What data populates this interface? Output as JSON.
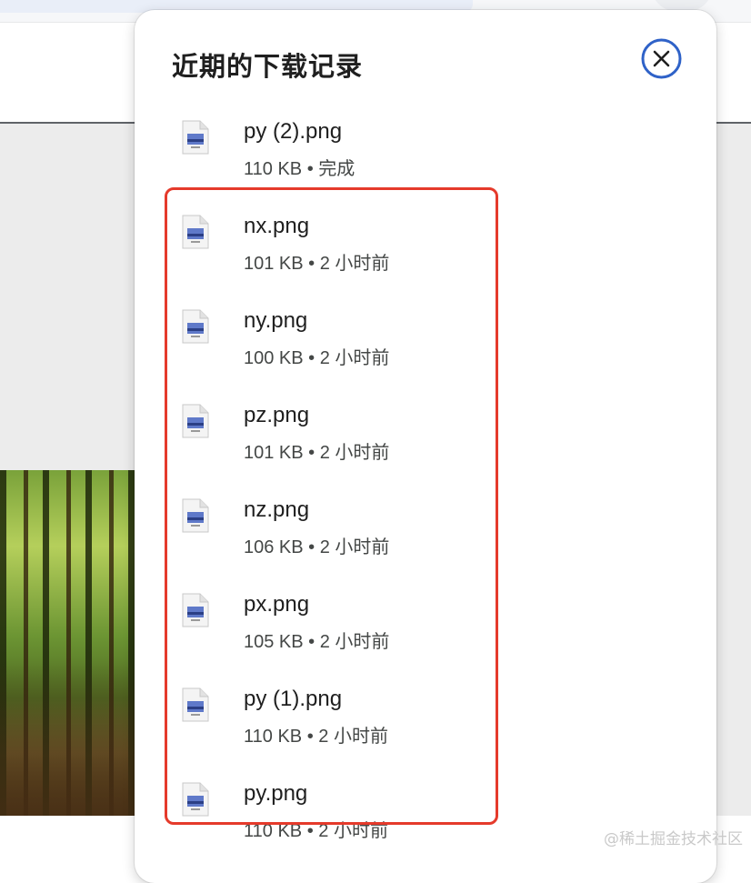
{
  "panel": {
    "title": "近期的下载记录",
    "close_icon": "close-circle-icon"
  },
  "downloads": [
    {
      "name": "py (2).png",
      "size": "110 KB",
      "separator": "•",
      "status": "完成",
      "icon": "image-file-icon"
    },
    {
      "name": "nx.png",
      "size": "101 KB",
      "separator": "•",
      "status": "2 小时前",
      "icon": "image-file-icon"
    },
    {
      "name": "ny.png",
      "size": "100 KB",
      "separator": "•",
      "status": "2 小时前",
      "icon": "image-file-icon"
    },
    {
      "name": "pz.png",
      "size": "101 KB",
      "separator": "•",
      "status": "2 小时前",
      "icon": "image-file-icon"
    },
    {
      "name": "nz.png",
      "size": "106 KB",
      "separator": "•",
      "status": "2 小时前",
      "icon": "image-file-icon"
    },
    {
      "name": "px.png",
      "size": "105 KB",
      "separator": "•",
      "status": "2 小时前",
      "icon": "image-file-icon"
    },
    {
      "name": "py (1).png",
      "size": "110 KB",
      "separator": "•",
      "status": "2 小时前",
      "icon": "image-file-icon"
    },
    {
      "name": "py.png",
      "size": "110 KB",
      "separator": "•",
      "status": "2 小时前",
      "icon": "image-file-icon"
    }
  ],
  "watermark": "@稀土掘金技术社区",
  "colors": {
    "highlight": "#e53a2b",
    "close_icon": "#2f62c8"
  }
}
